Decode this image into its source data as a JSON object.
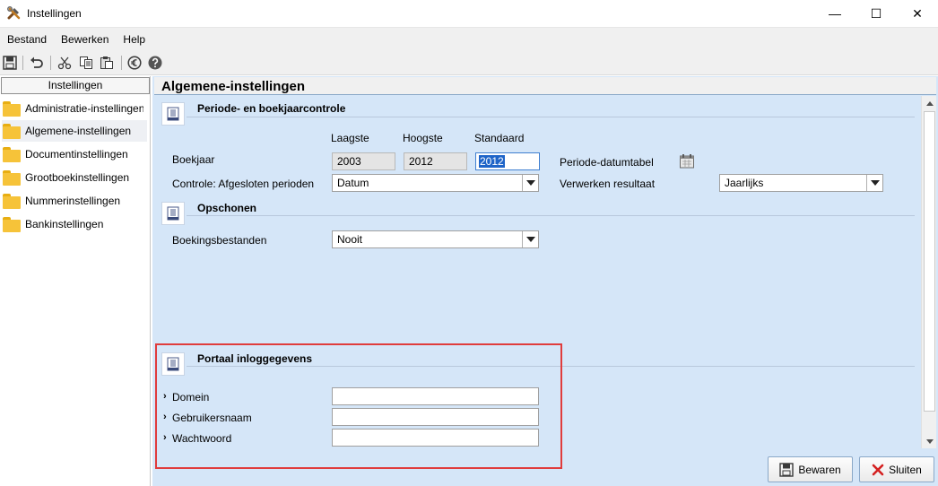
{
  "window": {
    "title": "Instellingen",
    "minimize_glyph": "—",
    "maximize_glyph": "☐",
    "close_glyph": "✕"
  },
  "menu": {
    "items": [
      "Bestand",
      "Bewerken",
      "Help"
    ]
  },
  "toolbar": {
    "icons": [
      "save-icon",
      "undo-icon",
      "cut-icon",
      "copy-icon",
      "paste-icon",
      "euro-icon",
      "help-icon"
    ]
  },
  "sidebar": {
    "header": "Instellingen",
    "items": [
      {
        "label": "Administratie-instellingen",
        "selected": false
      },
      {
        "label": "Algemene-instellingen",
        "selected": true
      },
      {
        "label": "Documentinstellingen",
        "selected": false
      },
      {
        "label": "Grootboekinstellingen",
        "selected": false
      },
      {
        "label": "Nummerinstellingen",
        "selected": false
      },
      {
        "label": "Bankinstellingen",
        "selected": false
      }
    ]
  },
  "main": {
    "title": "Algemene-instellingen",
    "periode": {
      "section_title": "Periode- en boekjaarcontrole",
      "col_laagste": "Laagste",
      "col_hoogste": "Hoogste",
      "col_standaard": "Standaard",
      "boekjaar_label": "Boekjaar",
      "laagste_value": "2003",
      "hoogste_value": "2012",
      "standaard_value": "2012",
      "controle_label": "Controle: Afgesloten perioden",
      "controle_value": "Datum",
      "periode_datumtabel_label": "Periode-datumtabel",
      "verwerken_label": "Verwerken resultaat",
      "verwerken_value": "Jaarlijks"
    },
    "opschonen": {
      "section_title": "Opschonen",
      "boekingsbestanden_label": "Boekingsbestanden",
      "boekingsbestanden_value": "Nooit"
    },
    "portaal": {
      "section_title": "Portaal inloggegevens",
      "domein_label": "Domein",
      "domein_value": "",
      "gebruikersnaam_label": "Gebruikersnaam",
      "gebruikersnaam_value": "",
      "wachtwoord_label": "Wachtwoord",
      "wachtwoord_value": ""
    }
  },
  "buttons": {
    "save_label": "Bewaren",
    "close_label": "Sluiten"
  },
  "colors": {
    "content_bg": "#d5e6f8",
    "highlight": "#e03c3c",
    "selection": "#1e64c8"
  }
}
